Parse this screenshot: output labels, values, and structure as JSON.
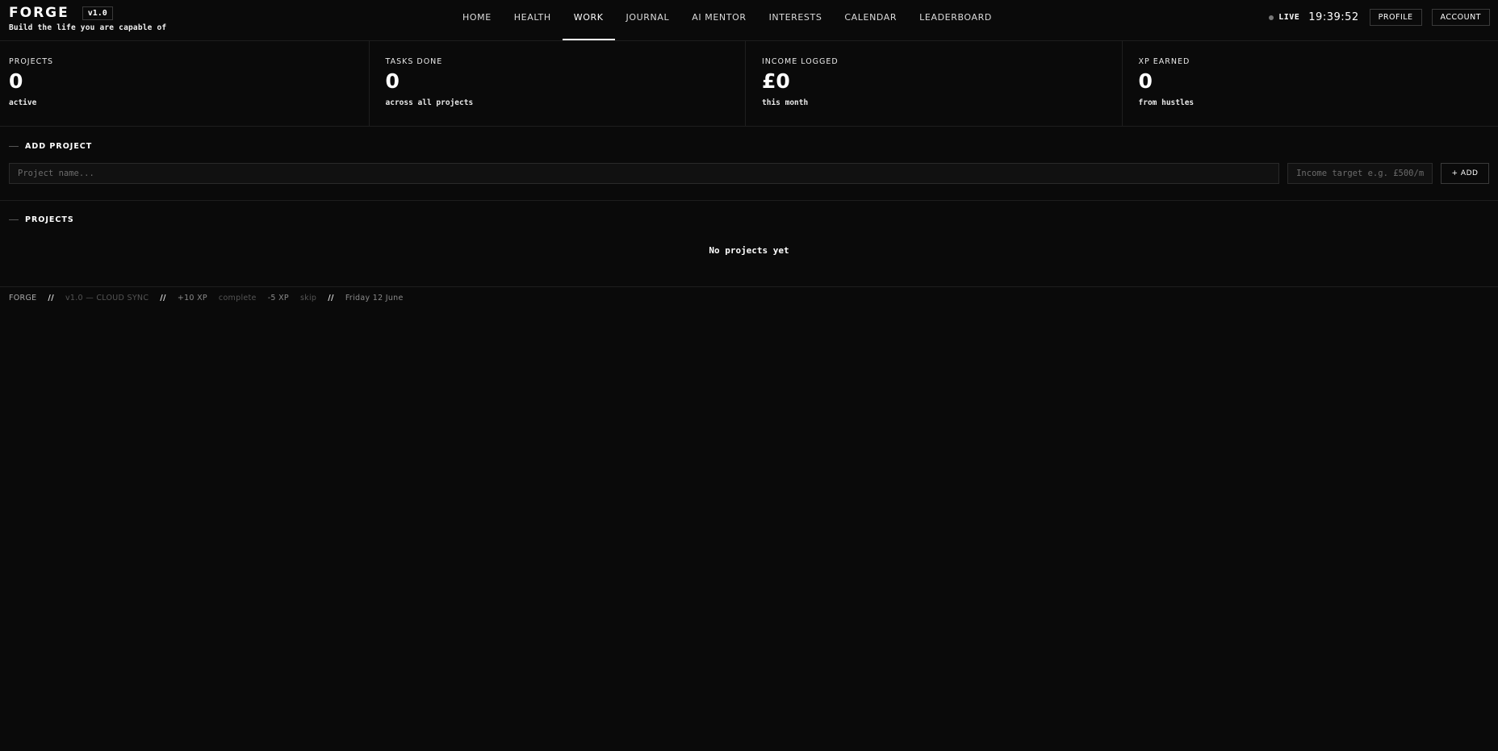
{
  "header": {
    "logo": "FORGE",
    "version": "v1.0",
    "tagline": "Build the life you are capable of",
    "nav": [
      {
        "label": "HOME",
        "active": false
      },
      {
        "label": "HEALTH",
        "active": false
      },
      {
        "label": "WORK",
        "active": true
      },
      {
        "label": "JOURNAL",
        "active": false
      },
      {
        "label": "AI MENTOR",
        "active": false
      },
      {
        "label": "INTERESTS",
        "active": false
      },
      {
        "label": "CALENDAR",
        "active": false
      },
      {
        "label": "LEADERBOARD",
        "active": false
      }
    ],
    "live_label": "LIVE",
    "clock": "19:39:52",
    "profile_label": "PROFILE",
    "account_label": "ACCOUNT"
  },
  "stats": [
    {
      "label": "PROJECTS",
      "value": "0",
      "sub": "active"
    },
    {
      "label": "TASKS DONE",
      "value": "0",
      "sub": "across all projects"
    },
    {
      "label": "INCOME LOGGED",
      "value": "£0",
      "sub": "this month"
    },
    {
      "label": "XP EARNED",
      "value": "0",
      "sub": "from hustles"
    }
  ],
  "add_project": {
    "title": "ADD PROJECT",
    "name_placeholder": "Project name...",
    "target_placeholder": "Income target e.g. £500/m",
    "add_label": "+ ADD"
  },
  "projects": {
    "title": "PROJECTS",
    "empty_text": "No projects yet"
  },
  "footer": {
    "brand": "FORGE",
    "sep": "//",
    "version": "v1.0 — CLOUD SYNC",
    "xp_plus": "+10 XP",
    "complete": "complete",
    "xp_minus": "-5 XP",
    "skip": "skip",
    "date": "Friday 12 June"
  },
  "colors": {
    "background": "#0a0a0a",
    "border": "#1e1e1e",
    "text": "#ffffff"
  }
}
